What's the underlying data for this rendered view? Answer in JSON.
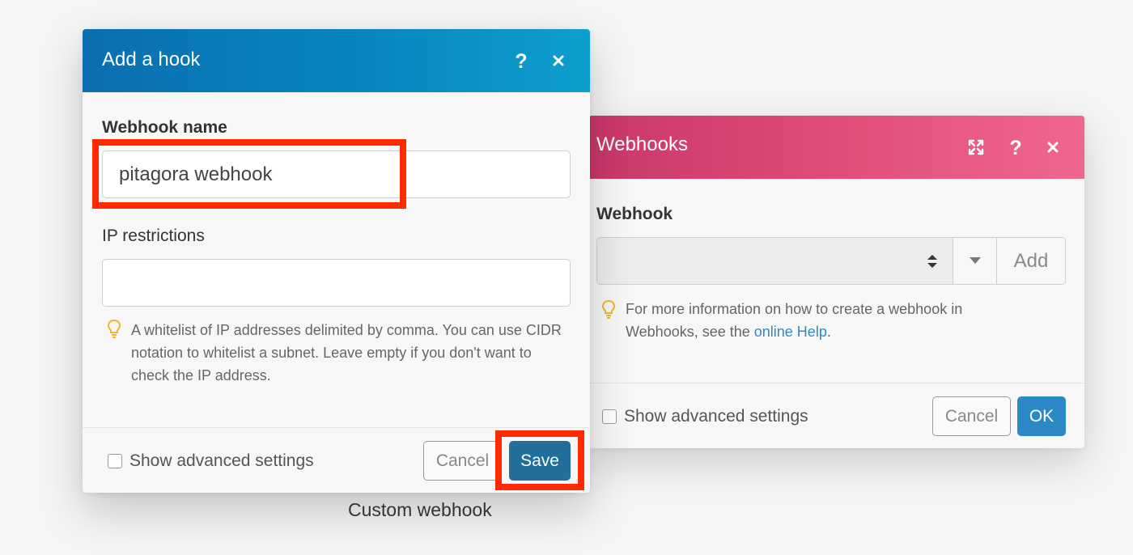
{
  "webhooks_dialog": {
    "title": "Webhooks",
    "field_label": "Webhook",
    "select_value": "",
    "add_label": "Add",
    "help_prefix": "For more information on how to create a webhook in Webhooks, see the ",
    "help_link": "online Help",
    "help_suffix": ".",
    "advanced_label": "Show advanced settings",
    "cancel_label": "Cancel",
    "ok_label": "OK",
    "header_icons": [
      "expand-icon",
      "help-icon",
      "close-icon"
    ],
    "header_color": "#dd4a76"
  },
  "hook_dialog": {
    "title": "Add a hook",
    "name_label": "Webhook name",
    "name_value": "pitagora webhook",
    "ip_label": "IP restrictions",
    "ip_value": "",
    "help_text": "A whitelist of IP addresses delimited by comma. You can use CIDR notation to whitelist a subnet. Leave empty if you don't want to check the IP address.",
    "advanced_label": "Show advanced settings",
    "cancel_label": "Cancel",
    "save_label": "Save",
    "header_icons": [
      "help-icon",
      "close-icon"
    ],
    "header_color": "#0785bf"
  },
  "caption": "Custom webhook",
  "highlight_color": "#ff2a00"
}
